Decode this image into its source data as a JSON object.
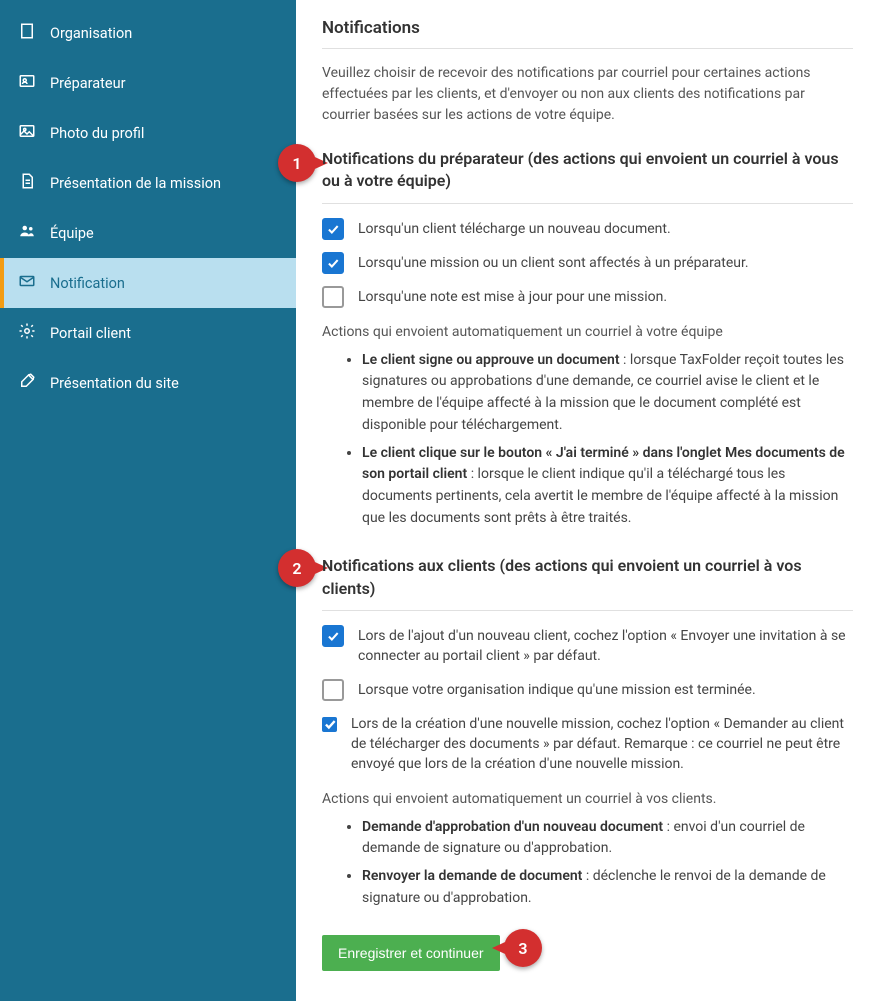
{
  "sidebar": {
    "items": [
      {
        "label": "Organisation",
        "icon": "building-icon"
      },
      {
        "label": "Préparateur",
        "icon": "id-card-icon"
      },
      {
        "label": "Photo du profil",
        "icon": "image-icon"
      },
      {
        "label": "Présentation de la mission",
        "icon": "document-icon"
      },
      {
        "label": "Équipe",
        "icon": "team-icon"
      },
      {
        "label": "Notification",
        "icon": "mail-icon",
        "active": true
      },
      {
        "label": "Portail client",
        "icon": "gear-icon"
      },
      {
        "label": "Présentation du site",
        "icon": "brush-icon"
      }
    ]
  },
  "page": {
    "title": "Notifications",
    "intro": "Veuillez choisir de recevoir des notifications par courriel pour certaines actions effectuées par les clients, et d'envoyer ou non aux clients des notifications par courrier basées sur les actions de votre équipe."
  },
  "steps": {
    "s1": "1",
    "s2": "2",
    "s3": "3"
  },
  "section1": {
    "heading": "Notifications du préparateur (des actions qui envoient un courriel à vous ou à votre équipe)",
    "cb1": {
      "label": "Lorsqu'un client télécharge un nouveau document.",
      "checked": true
    },
    "cb2": {
      "label": "Lorsqu'une mission ou un client sont affectés à un préparateur.",
      "checked": true
    },
    "cb3": {
      "label": "Lorsqu'une note est mise à jour pour une mission.",
      "checked": false
    },
    "auto_caption": "Actions qui envoient automatiquement un courriel à votre équipe",
    "auto1_bold": "Le client signe ou approuve un document",
    "auto1_rest": " : lorsque TaxFolder reçoit toutes les signatures ou approbations d'une demande, ce courriel avise le client et le membre de l'équipe affecté à la mission que le document complété est disponible pour téléchargement.",
    "auto2_bold": "Le client clique sur le bouton « J'ai terminé » dans l'onglet Mes documents de son portail client",
    "auto2_rest": " : lorsque le client indique qu'il a  téléchargé tous les documents pertinents, cela avertit le membre de l'équipe affecté à la mission que les documents sont prêts à être traités."
  },
  "section2": {
    "heading": "Notifications aux clients (des actions qui envoient un courriel à vos clients)",
    "cb1": {
      "label": "Lors de l'ajout d'un nouveau client, cochez l'option « Envoyer une invitation à se connecter au portail client » par défaut.",
      "checked": true
    },
    "cb2": {
      "label": "Lorsque votre organisation indique qu'une mission est terminée.",
      "checked": false
    },
    "cb3": {
      "label": "Lors de la création d'une nouvelle mission, cochez l'option « Demander au client de télécharger des documents » par défaut. Remarque : ce courriel ne peut être envoyé que lors de la création d'une nouvelle mission.",
      "checked": true
    },
    "auto_caption": "Actions qui envoient automatiquement un courriel à vos clients.",
    "auto1_bold": "Demande d'approbation d'un nouveau document",
    "auto1_rest": " : envoi d'un courriel de demande de signature ou d'approbation.",
    "auto2_bold": "Renvoyer la demande de document",
    "auto2_rest": " : déclenche le renvoi de la demande de signature ou d'approbation."
  },
  "save": {
    "label": "Enregistrer et continuer"
  }
}
